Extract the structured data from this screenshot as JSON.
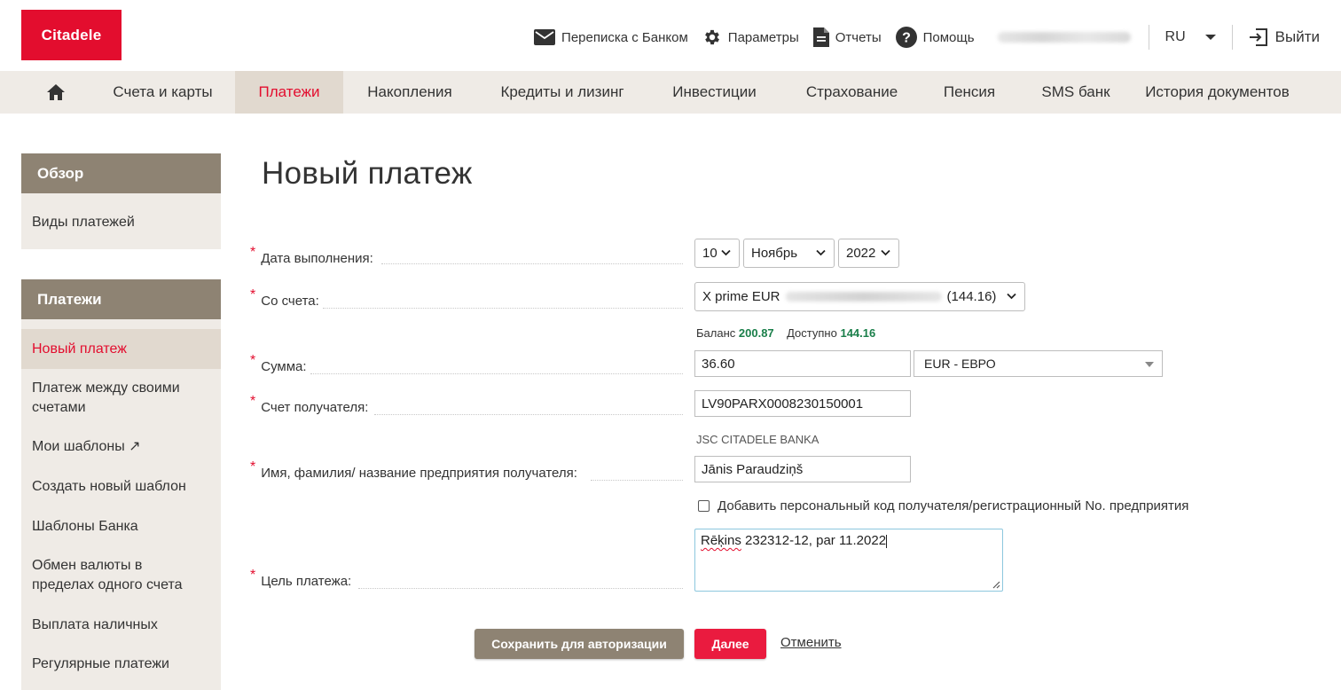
{
  "header": {
    "logo": "Citadele",
    "links": [
      {
        "label": "Переписка с Банком",
        "icon": "mail-icon"
      },
      {
        "label": "Параметры",
        "icon": "gear-icon"
      },
      {
        "label": "Отчеты",
        "icon": "document-icon"
      },
      {
        "label": "Помощь",
        "icon": "help-icon"
      }
    ],
    "language": "RU",
    "logout": "Выйти"
  },
  "nav": {
    "items": [
      "Счета и карты",
      "Платежи",
      "Накопления",
      "Кредиты и лизинг",
      "Инвестиции",
      "Страхование",
      "Пенсия",
      "SMS банк",
      "История документов"
    ],
    "active": "Платежи"
  },
  "sidebar": {
    "overview_title": "Обзор",
    "overview_items": [
      "Виды платежей"
    ],
    "payments_title": "Платежи",
    "payments_items": [
      "Новый платеж",
      "Платеж между своими счетами",
      "Мои шаблоны ↗",
      "Создать новый шаблон",
      "Шаблоны Банка",
      "Обмен валюты в пределах одного счета",
      "Выплата наличных",
      "Регулярные платежи"
    ]
  },
  "main": {
    "title": "Новый платеж",
    "labels": {
      "date": "Дата выполнения:",
      "from_account": "Со счета:",
      "amount": "Сумма:",
      "beneficiary_account": "Счет получателя:",
      "beneficiary_name": "Имя, фамилия/ название предприятия получателя:",
      "purpose": "Цель платежа:"
    },
    "date": {
      "day": "10",
      "month": "Ноябрь",
      "year": "2022"
    },
    "account": {
      "name": "X prime EUR",
      "amount": "(144.16)"
    },
    "balance_label": "Баланс",
    "balance_value": "200.87",
    "available_label": "Доступно",
    "available_value": "144.16",
    "amount_value": "36.60",
    "currency": "EUR - ЕВРО",
    "beneficiary_account": "LV90PARX0008230150001",
    "bank_name": "JSC CITADELE BANKA",
    "beneficiary_name": "Jānis Paraudziņš",
    "add_code_label": "Добавить персональный код получателя/регистрационный No. предприятия",
    "purpose_word1": "Rēķins",
    "purpose_rest": " 232312-12, par 11.2022"
  },
  "buttons": {
    "save": "Сохранить для авторизации",
    "next": "Далее",
    "cancel": "Отменить"
  },
  "colors": {
    "brand_red": "#e30d2e",
    "taupe": "#8e8373",
    "nav_bg": "#efebe6",
    "green": "#1a7f4a"
  }
}
